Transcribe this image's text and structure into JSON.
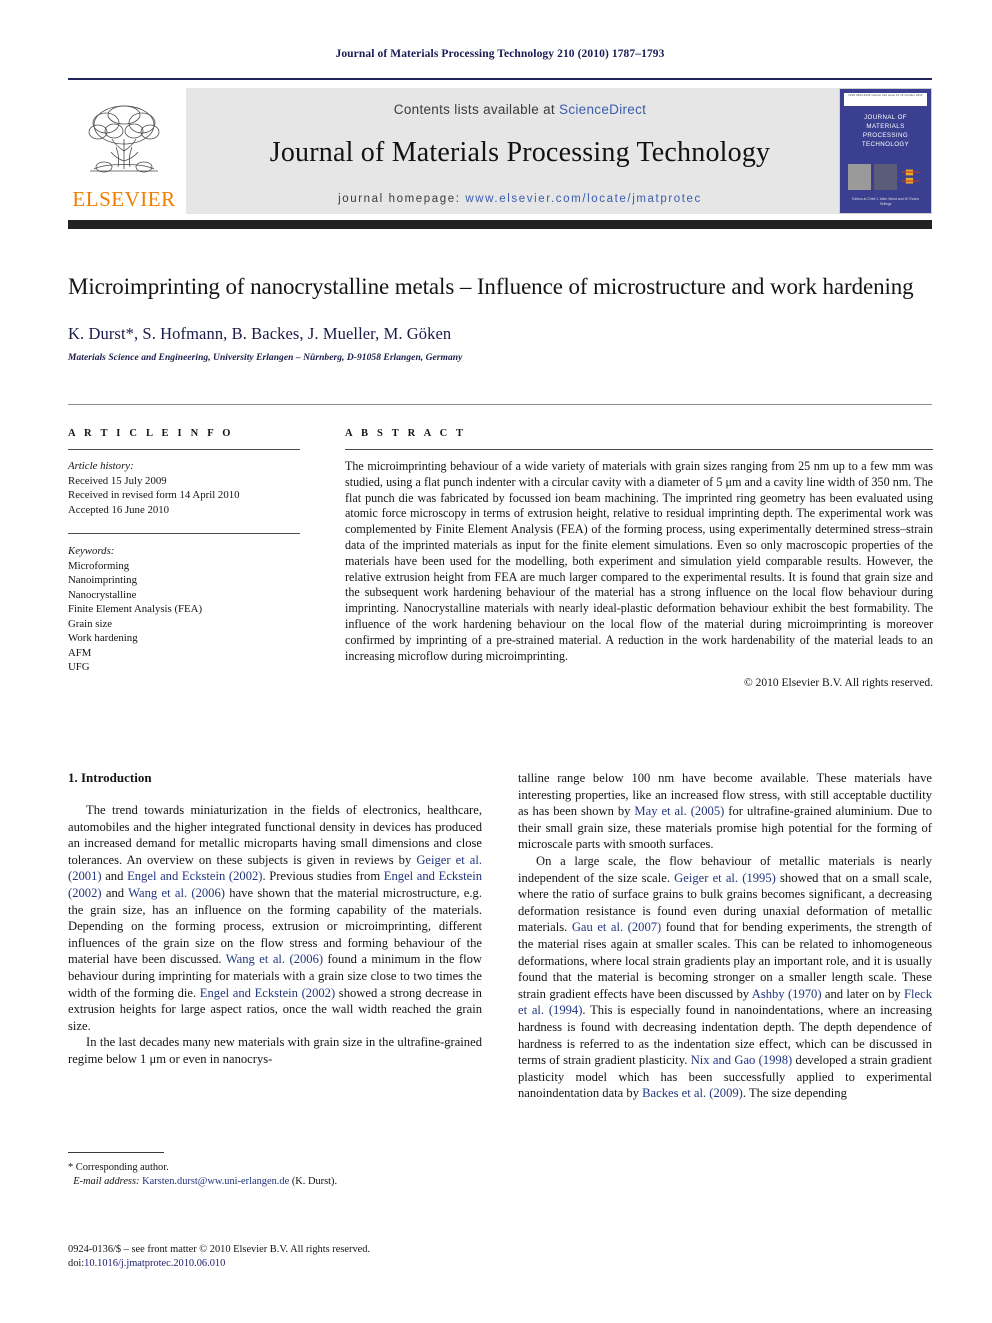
{
  "running_head": "Journal of Materials Processing Technology 210 (2010) 1787–1793",
  "masthead": {
    "publisher_name": "ELSEVIER",
    "contents_prefix": "Contents lists available at ",
    "contents_link": "ScienceDirect",
    "journal_title": "Journal of Materials Processing Technology",
    "homepage_prefix": "journal homepage:",
    "homepage_url": "www.elsevier.com/locate/jmatprotec",
    "cover": {
      "top_strip": "ISSN 0924-0136   Volume 210   Issue 13   15 October 2010",
      "title": "JOURNAL OF MATERIALS PROCESSING TECHNOLOGY",
      "footer": "Editors-in-Chief\nJ. Allen Wood and W. Evans Sellings"
    }
  },
  "article": {
    "title": "Microimprinting of nanocrystalline metals – Influence of microstructure and work hardening",
    "authors": "K. Durst*, S. Hofmann, B. Backes, J. Mueller, M. Göken",
    "affiliation": "Materials Science and Engineering, University Erlangen – Nürnberg, D-91058 Erlangen, Germany"
  },
  "info": {
    "heading": "A R T I C L E    I N F O",
    "history_label": "Article history:",
    "history": [
      "Received 15 July 2009",
      "Received in revised form 14 April 2010",
      "Accepted 16 June 2010"
    ],
    "keywords_label": "Keywords:",
    "keywords": [
      "Microforming",
      "Nanoimprinting",
      "Nanocrystalline",
      "Finite Element Analysis (FEA)",
      "Grain size",
      "Work hardening",
      "AFM",
      "UFG"
    ]
  },
  "abstract": {
    "heading": "A B S T R A C T",
    "text": "The microimprinting behaviour of a wide variety of materials with grain sizes ranging from 25 nm up to a few mm was studied, using a flat punch indenter with a circular cavity with a diameter of 5 μm and a cavity line width of 350 nm. The flat punch die was fabricated by focussed ion beam machining. The imprinted ring geometry has been evaluated using atomic force microscopy in terms of extrusion height, relative to residual imprinting depth. The experimental work was complemented by Finite Element Analysis (FEA) of the forming process, using experimentally determined stress–strain data of the imprinted materials as input for the finite element simulations. Even so only macroscopic properties of the materials have been used for the modelling, both experiment and simulation yield comparable results. However, the relative extrusion height from FEA are much larger compared to the experimental results. It is found that grain size and the subsequent work hardening behaviour of the material has a strong influence on the local flow behaviour during imprinting. Nanocrystalline materials with nearly ideal-plastic deformation behaviour exhibit the best formability. The influence of the work hardening behaviour on the local flow of the material during microimprinting is moreover confirmed by imprinting of a pre-strained material. A reduction in the work hardenability of the material leads to an increasing microflow during microimprinting.",
    "copyright": "© 2010 Elsevier B.V. All rights reserved."
  },
  "body": {
    "section_heading": "1.  Introduction",
    "left_paragraphs": [
      "The trend towards miniaturization in the fields of electronics, healthcare, automobiles and the higher integrated functional density in devices has produced an increased demand for metallic microparts having small dimensions and close tolerances. An overview on these subjects is given in reviews by Geiger et al. (2001) and Engel and Eckstein (2002). Previous studies from Engel and Eckstein (2002) and Wang et al. (2006) have shown that the material microstructure, e.g. the grain size, has an influence on the forming capability of the materials. Depending on the forming process, extrusion or microimprinting, different influences of the grain size on the flow stress and forming behaviour of the material have been discussed. Wang et al. (2006) found a minimum in the flow behaviour during imprinting for materials with a grain size close to two times the width of the forming die. Engel and Eckstein (2002) showed a strong decrease in extrusion heights for large aspect ratios, once the wall width reached the grain size.",
      "In the last decades many new materials with grain size in the ultrafine-grained regime below 1 μm or even in nanocrys-"
    ],
    "right_paragraphs": [
      "talline range below 100 nm have become available. These materials have interesting properties, like an increased flow stress, with still acceptable ductility as has been shown by May et al. (2005) for ultrafine-grained aluminium. Due to their small grain size, these materials promise high potential for the forming of microscale parts with smooth surfaces.",
      "On a large scale, the flow behaviour of metallic materials is nearly independent of the size scale. Geiger et al. (1995) showed that on a small scale, where the ratio of surface grains to bulk grains becomes significant, a decreasing deformation resistance is found even during unaxial deformation of metallic materials. Gau et al. (2007) found that for bending experiments, the strength of the material rises again at smaller scales. This can be related to inhomogeneous deformations, where local strain gradients play an important role, and it is usually found that the material is becoming stronger on a smaller length scale. These strain gradient effects have been discussed by Ashby (1970) and later on by Fleck et al. (1994). This is especially found in nanoindentations, where an increasing hardness is found with decreasing indentation depth. The depth dependence of hardness is referred to as the indentation size effect, which can be discussed in terms of strain gradient plasticity. Nix and Gao (1998) developed a strain gradient plasticity model which has been successfully applied to experimental nanoindentation data by Backes et al. (2009). The size depending"
    ],
    "citations_left": [
      "Geiger et al. (2001)",
      "Engel and Eckstein (2002)",
      "Engel and Eckstein (2002)",
      "Wang et al. (2006)",
      "Wang et al. (2006)",
      "Engel and Eckstein (2002)"
    ],
    "citations_right": [
      "May et al. (2005)",
      "Geiger et al. (1995)",
      "Gau et al. (2007)",
      "Ashby (1970)",
      "Fleck et al. (1994)",
      "Nix and Gao (1998)",
      "Backes et al. (2009)"
    ]
  },
  "footnote": {
    "corresponding": "* Corresponding author.",
    "email_label": "E-mail address:",
    "email": "Karsten.durst@ww.uni-erlangen.de",
    "email_suffix": "(K. Durst)."
  },
  "imprint": {
    "line1": "0924-0136/$ – see front matter © 2010 Elsevier B.V. All rights reserved.",
    "doi_label": "doi:",
    "doi": "10.1016/j.jmatprotec.2010.06.010"
  },
  "colors": {
    "elsevier_orange": "#ef7d00",
    "link_blue": "#22357e",
    "running_head_navy": "#1b1b55",
    "banner_grey": "#e6e6e6",
    "bar_black": "#232323"
  }
}
